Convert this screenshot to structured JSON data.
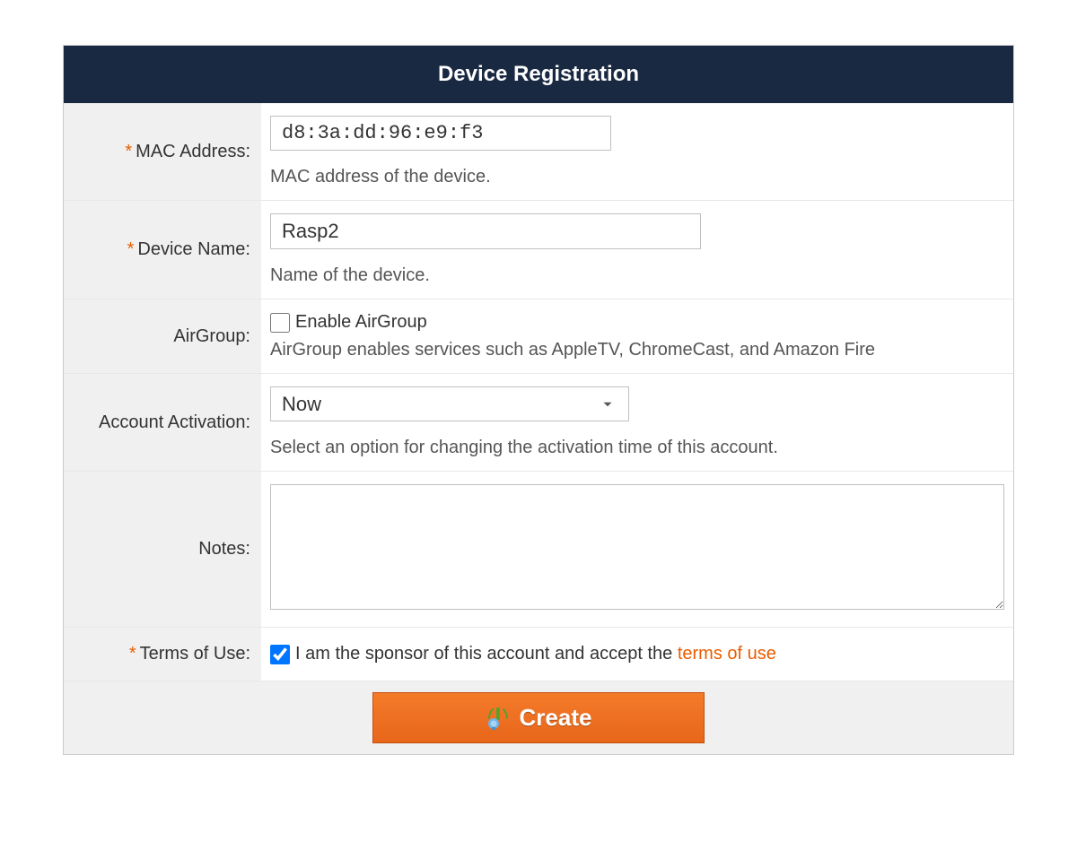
{
  "header": {
    "title": "Device Registration"
  },
  "fields": {
    "mac": {
      "label": "MAC Address:",
      "value": "d8:3a:dd:96:e9:f3",
      "help": "MAC address of the device.",
      "required": true
    },
    "device_name": {
      "label": "Device Name:",
      "value": "Rasp2",
      "help": "Name of the device.",
      "required": true
    },
    "airgroup": {
      "label": "AirGroup:",
      "checkbox_label": "Enable AirGroup",
      "checked": false,
      "help": "AirGroup enables services such as AppleTV, ChromeCast, and Amazon Fire"
    },
    "activation": {
      "label": "Account Activation:",
      "selected": "Now",
      "help": "Select an option for changing the activation time of this account."
    },
    "notes": {
      "label": "Notes:",
      "value": ""
    },
    "terms": {
      "label": "Terms of Use:",
      "checked": true,
      "text_prefix": "I am the sponsor of this account and accept the ",
      "link_text": "terms of use",
      "required": true
    }
  },
  "buttons": {
    "create": "Create"
  }
}
